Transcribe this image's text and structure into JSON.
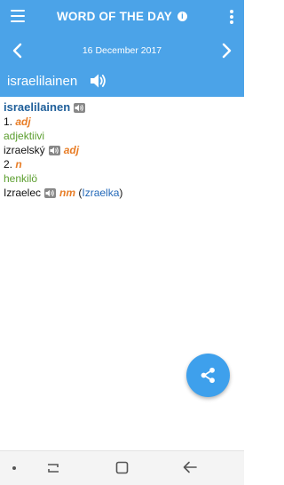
{
  "appbar": {
    "title": "WORD OF THE DAY",
    "icons": {
      "menu": "hamburger-icon",
      "info": "info-icon",
      "more": "kebab-icon"
    }
  },
  "datebar": {
    "date": "16 December 2017",
    "icons": {
      "prev": "chevron-left-icon",
      "next": "chevron-right-icon"
    }
  },
  "word": {
    "text": "israelilainen",
    "icon": "speaker-icon"
  },
  "entry": {
    "headword": "israelilainen",
    "sense1": {
      "number": "1.",
      "pos": "adj",
      "gloss": "adjektiivi"
    },
    "translation1": {
      "word": "izraelský",
      "pos": "adj"
    },
    "sense2": {
      "number": "2.",
      "pos": "n",
      "gloss": "henkilö"
    },
    "translation2": {
      "word": "Izraelec",
      "pos": "nm",
      "open_paren": "(",
      "feminine": "Izraelka",
      "close_paren": ")"
    }
  },
  "fab": {
    "icon": "share-icon"
  },
  "navbar": {
    "icons": [
      "dot-icon",
      "recents-icon",
      "home-icon",
      "back-icon"
    ]
  },
  "colors": {
    "appbar": "#4ba3e8",
    "fab": "#3ea0ec",
    "headword": "#1f5f9a",
    "pos": "#e87d26",
    "gloss": "#5b9e2e",
    "link": "#2368b8"
  }
}
